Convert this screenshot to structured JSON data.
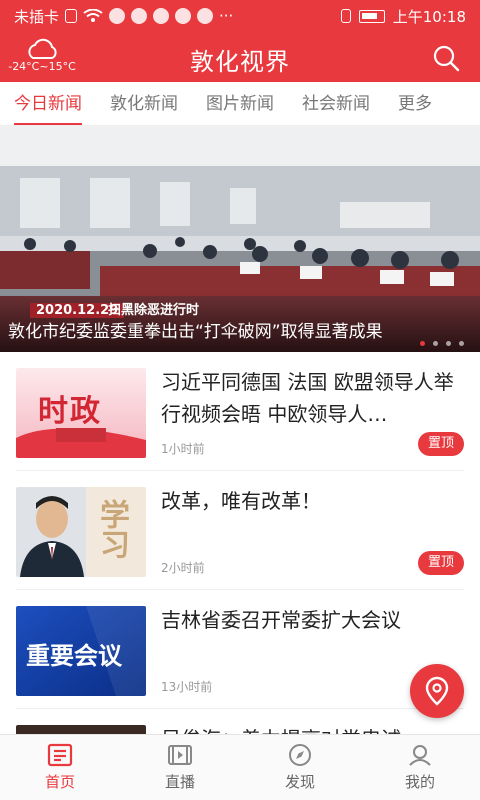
{
  "status_bar": {
    "carrier": "未插卡",
    "time": "上午10:18"
  },
  "header": {
    "weather": "-24°C~15°C",
    "title": "敦化视界"
  },
  "tabs": [
    {
      "label": "今日新闻",
      "active": true
    },
    {
      "label": "敦化新闻",
      "active": false
    },
    {
      "label": "图片新闻",
      "active": false
    },
    {
      "label": "社会新闻",
      "active": false
    },
    {
      "label": "更多",
      "active": false
    }
  ],
  "banner": {
    "date": "2020.12.29",
    "subtitle": "扫黑除恶进行时",
    "title": "敦化市纪委监委重拳出击“打伞破网”取得显著成果",
    "slide_count": 4,
    "active_slide": 1
  },
  "news": [
    {
      "thumb_text": "时政",
      "title": "习近平同德国 法国 欧盟领导人举行视频会晤 中欧领导人…",
      "time": "1小时前",
      "badge": "置顶"
    },
    {
      "thumb_text": "学习",
      "title": "改革，唯有改革！",
      "time": "2小时前",
      "badge": "置顶"
    },
    {
      "thumb_text": "重要会议",
      "title": "吉林省委召开常委扩大会议",
      "time": "13小时前",
      "badge": ""
    },
    {
      "thumb_text": "",
      "title": "吴俊海：着力提高对党忠诚",
      "time": "",
      "badge": ""
    }
  ],
  "bottom_nav": [
    {
      "label": "首页",
      "icon": "home-icon",
      "active": true
    },
    {
      "label": "直播",
      "icon": "live-icon",
      "active": false
    },
    {
      "label": "发现",
      "icon": "compass-icon",
      "active": false
    },
    {
      "label": "我的",
      "icon": "profile-icon",
      "active": false
    }
  ],
  "colors": {
    "brand": "#e8393e",
    "inactive": "#777777"
  }
}
